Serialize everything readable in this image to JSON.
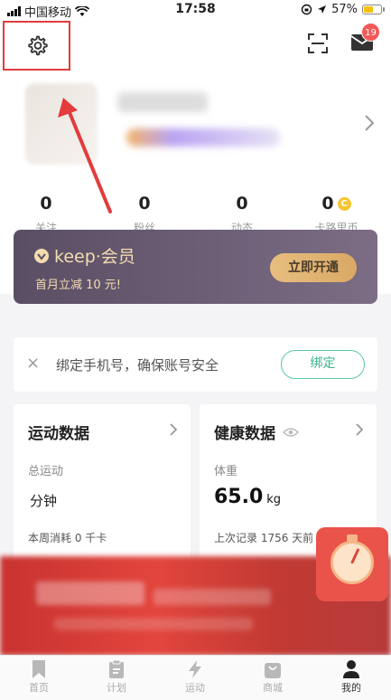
{
  "status_bar": {
    "carrier": "中国移动",
    "time": "17:58",
    "battery_percent": "57%",
    "battery_level": 0.57
  },
  "header": {
    "notification_count": "19"
  },
  "stats": [
    {
      "value": "0",
      "label": "关注"
    },
    {
      "value": "0",
      "label": "粉丝"
    },
    {
      "value": "0",
      "label": "动态"
    },
    {
      "value": "0",
      "label": "卡路里币"
    }
  ],
  "vip": {
    "logo_text": "keep·会员",
    "subtitle": "首月立减 10 元!",
    "button_label": "立即开通"
  },
  "bind_phone": {
    "close": "×",
    "text": "绑定手机号，确保账号安全",
    "button_label": "绑定"
  },
  "sport_card": {
    "title": "运动数据",
    "subtitle": "总运动",
    "value": "分钟",
    "footer": "本周消耗 0 千卡"
  },
  "health_card": {
    "title": "健康数据",
    "subtitle": "体重",
    "value": "65.0",
    "unit": "kg",
    "footer": "上次记录 1756 天前"
  },
  "tabs": [
    {
      "label": "首页",
      "icon": "bookmark-icon"
    },
    {
      "label": "计划",
      "icon": "clipboard-icon"
    },
    {
      "label": "运动",
      "icon": "lightning-icon"
    },
    {
      "label": "商城",
      "icon": "shopping-bag-icon"
    },
    {
      "label": "我的",
      "icon": "person-icon"
    }
  ],
  "colors": {
    "annotation_red": "#e23c3c",
    "accent_green": "#3bb58c",
    "vip_gold": "#f4dcb1"
  }
}
